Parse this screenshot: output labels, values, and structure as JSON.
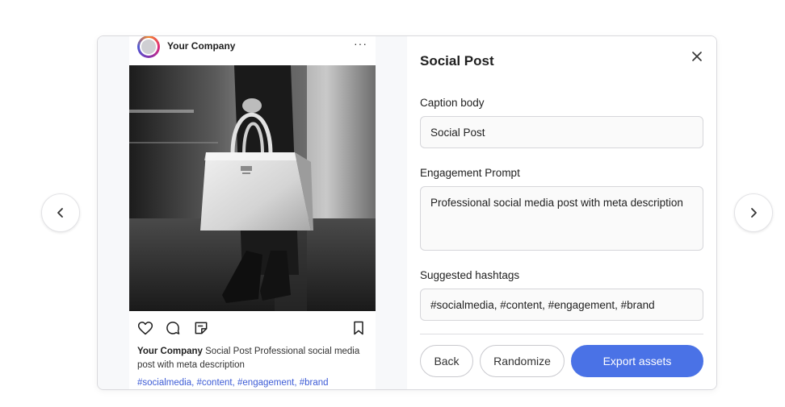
{
  "post": {
    "account_name": "Your Company",
    "more_label": "···",
    "caption_account": "Your Company",
    "caption_text": "Social Post Professional social media post with meta description",
    "hashtags": "#socialmedia, #content, #engagement, #brand",
    "icons": {
      "avatar": "avatar",
      "more": "more-horizontal-icon",
      "like": "heart-icon",
      "comment": "comment-icon",
      "share": "sticker-icon",
      "save": "bookmark-icon"
    }
  },
  "form": {
    "title": "Social Post",
    "caption_label": "Caption body",
    "caption_value": "Social Post",
    "prompt_label": "Engagement Prompt",
    "prompt_value": "Professional social media post with meta description",
    "hashtags_label": "Suggested hashtags",
    "hashtags_value": "#socialmedia, #content, #engagement, #brand",
    "close_icon": "close-icon"
  },
  "actions": {
    "back_label": "Back",
    "randomize_label": "Randomize",
    "export_label": "Export assets"
  },
  "carousel": {
    "prev_icon": "chevron-left-icon",
    "next_icon": "chevron-right-icon"
  },
  "colors": {
    "accent": "#4a72e6",
    "hashtag": "#3c5bd6",
    "pane_bg": "#f7f8fa"
  }
}
